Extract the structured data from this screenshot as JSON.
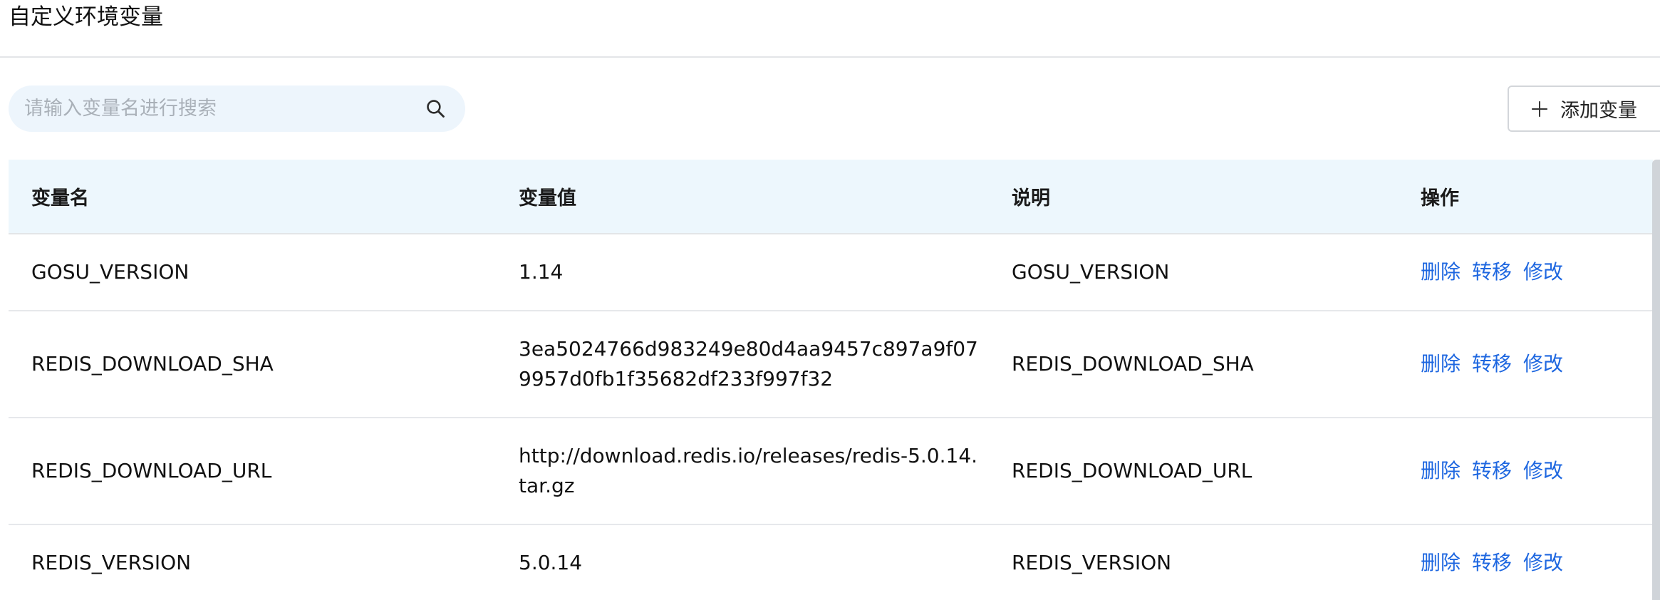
{
  "page": {
    "title": "自定义环境变量"
  },
  "search": {
    "placeholder": "请输入变量名进行搜索",
    "value": "",
    "icon": "search-icon"
  },
  "toolbar": {
    "add_label": "添加变量",
    "add_icon": "plus-icon"
  },
  "table": {
    "columns": [
      "变量名",
      "变量值",
      "说明",
      "操作"
    ],
    "rows": [
      {
        "name": "GOSU_VERSION",
        "value": "1.14",
        "desc": "GOSU_VERSION",
        "ops": [
          "删除",
          "转移",
          "修改"
        ]
      },
      {
        "name": "REDIS_DOWNLOAD_SHA",
        "value": "3ea5024766d983249e80d4aa9457c897a9f079957d0fb1f35682df233f997f32",
        "desc": "REDIS_DOWNLOAD_SHA",
        "ops": [
          "删除",
          "转移",
          "修改"
        ]
      },
      {
        "name": "REDIS_DOWNLOAD_URL",
        "value": "http://download.redis.io/releases/redis-5.0.14.tar.gz",
        "desc": "REDIS_DOWNLOAD_URL",
        "ops": [
          "删除",
          "转移",
          "修改"
        ]
      },
      {
        "name": "REDIS_VERSION",
        "value": "5.0.14",
        "desc": "REDIS_VERSION",
        "ops": [
          "删除",
          "转移",
          "修改"
        ]
      }
    ]
  },
  "colors": {
    "link": "#1e67e0",
    "header_bg": "#edf7fd",
    "search_bg": "#edf5fc"
  }
}
